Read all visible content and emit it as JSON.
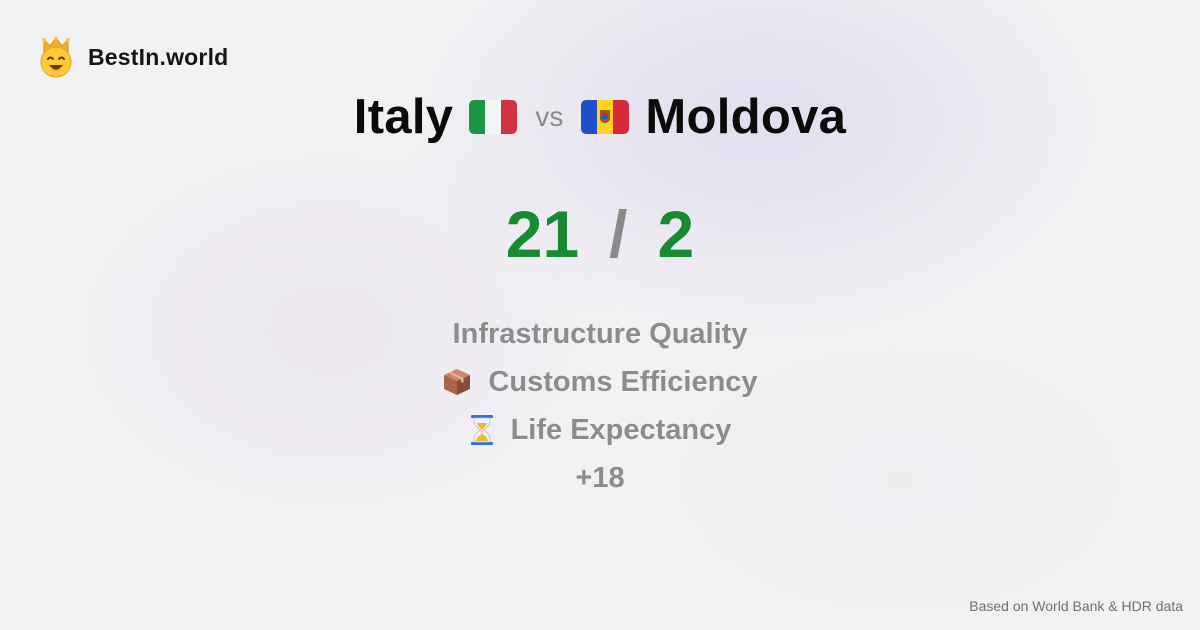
{
  "brand": {
    "name": "BestIn.world",
    "icon": "king-emoji-icon"
  },
  "comparison": {
    "left": {
      "name": "Italy",
      "flag": "italy-flag-icon"
    },
    "separator": "vs",
    "right": {
      "name": "Moldova",
      "flag": "moldova-flag-icon"
    }
  },
  "score": {
    "left": "21",
    "separator": "/",
    "right": "2",
    "color": "#188a32"
  },
  "metrics": [
    {
      "label": "Infrastructure Quality",
      "icon": ""
    },
    {
      "label": "Customs Efficiency",
      "icon": "package-icon"
    },
    {
      "label": "Life Expectancy",
      "icon": "hourglass-icon"
    }
  ],
  "more": "+18",
  "footer": "Based on World Bank & HDR data"
}
